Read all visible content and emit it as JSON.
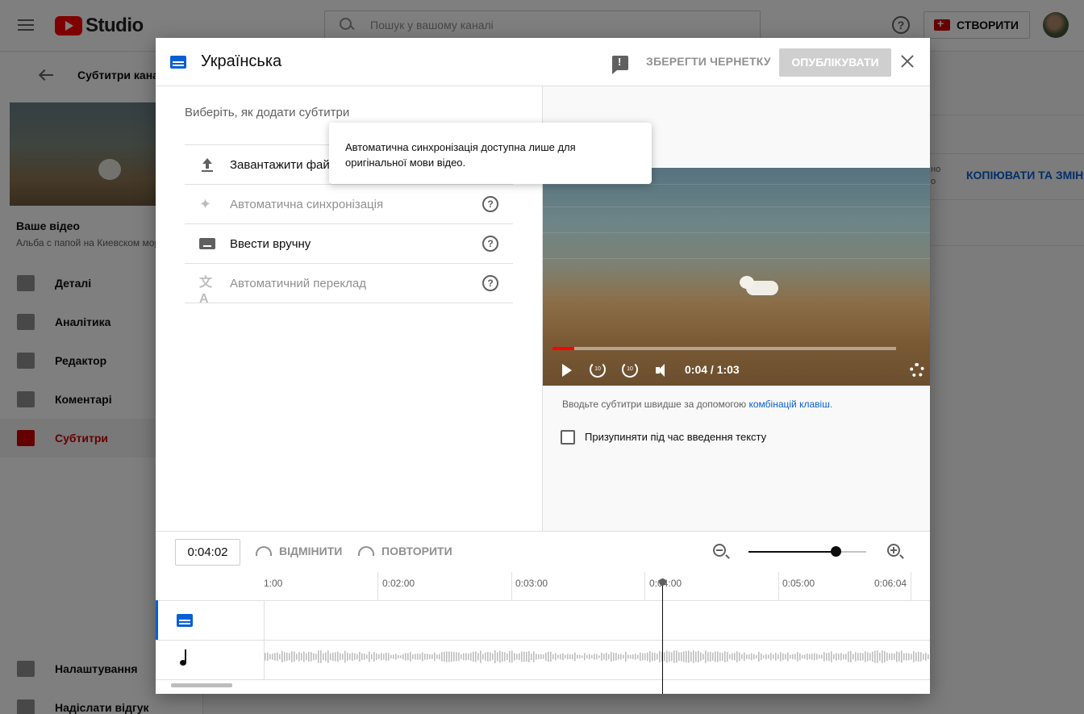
{
  "app": {
    "logo_text": "Studio",
    "search_placeholder": "Пошук у вашому каналі",
    "create_label": "СТВОРИТИ"
  },
  "sidebar": {
    "back_label": "Субтитри каналу",
    "your_video_label": "Ваше відео",
    "video_title": "Альба с папой на Киевском море",
    "items": [
      {
        "label": "Деталі",
        "icon": "pencil-icon"
      },
      {
        "label": "Аналітика",
        "icon": "analytics-icon"
      },
      {
        "label": "Редактор",
        "icon": "editor-icon"
      },
      {
        "label": "Коментарі",
        "icon": "comments-icon"
      },
      {
        "label": "Субтитри",
        "icon": "subtitles-icon",
        "active": true
      }
    ],
    "settings_label": "Налаштування",
    "feedback_label": "Надіслати відгук"
  },
  "background_main": {
    "copy_label": "КОПІЮВАТИ ТА ЗМІНИ",
    "fragment_line1": "но",
    "fragment_line2": "о"
  },
  "dialog": {
    "title": "Українська",
    "save_draft_label": "ЗБЕРЕГТИ ЧЕРНЕТКУ",
    "publish_label": "ОПУБЛІКУВАТИ",
    "choose_label": "Виберіть, як додати субтитри",
    "options": [
      {
        "label": "Завантажити файл",
        "icon": "upload-icon",
        "enabled": true
      },
      {
        "label": "Автоматична синхронізація",
        "icon": "sparkle-icon",
        "enabled": false
      },
      {
        "label": "Ввести вручну",
        "icon": "keyboard-icon",
        "enabled": true
      },
      {
        "label": "Автоматичний переклад",
        "icon": "translate-icon",
        "enabled": false
      }
    ],
    "tooltip_text": "Автоматична синхронізація доступна лише для оригінальної мови відео.",
    "hint_prefix": "Вводьте субтитри швидше за допомогою ",
    "hint_link": "комбінацій клавіш",
    "hint_suffix": ".",
    "pause_label": "Призупиняти під час введення тексту",
    "pause_checked": false
  },
  "player": {
    "current": "0:04",
    "duration": "1:03",
    "time_display": "0:04 / 1:03",
    "progress_fraction": 0.063,
    "rewind_label": "10",
    "forward_label": "10"
  },
  "timeline": {
    "timecode": "0:04:02",
    "undo_label": "ВІДМІНИТИ",
    "redo_label": "ПОВТОРИТИ",
    "zoom_fraction": 0.74,
    "ticks": [
      "1:00",
      "0:02:00",
      "0:03:00",
      "0:04:00",
      "0:05:00",
      "0:06:04"
    ]
  },
  "colors": {
    "accent_blue": "#065fd4",
    "brand_red": "#ff0000",
    "active_red": "#cc0000"
  }
}
